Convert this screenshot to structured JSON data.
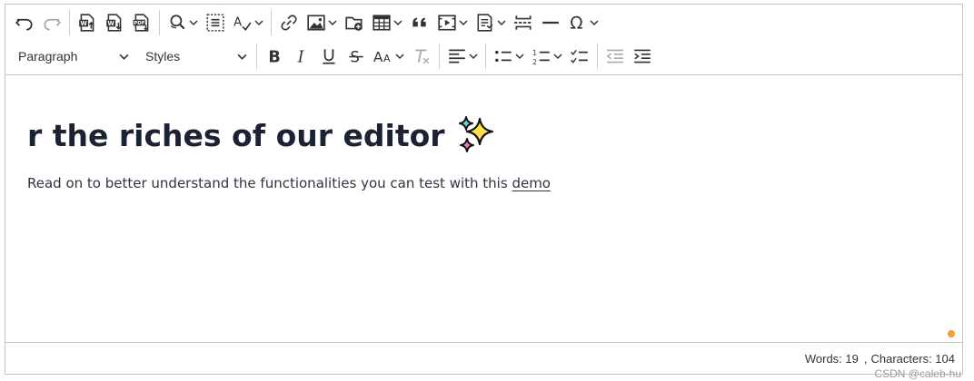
{
  "toolbar": {
    "row1": [
      {
        "icon": "undo-icon",
        "label": "Undo"
      },
      {
        "icon": "redo-icon",
        "label": "Redo"
      },
      {
        "icon": "import-word-icon",
        "label": "Import from Word"
      },
      {
        "icon": "export-word-icon",
        "label": "Export to Word"
      },
      {
        "icon": "export-pdf-icon",
        "label": "Export to PDF"
      },
      {
        "icon": "find-replace-icon",
        "label": "Find and replace"
      },
      {
        "icon": "select-all-icon",
        "label": "Select all"
      },
      {
        "icon": "spell-check-icon",
        "label": "Spell check"
      },
      {
        "icon": "link-icon",
        "label": "Link"
      },
      {
        "icon": "image-icon",
        "label": "Insert image"
      },
      {
        "icon": "media-browser-icon",
        "label": "Insert media"
      },
      {
        "icon": "table-icon",
        "label": "Insert table"
      },
      {
        "icon": "blockquote-icon",
        "label": "Block quote"
      },
      {
        "icon": "media-embed-icon",
        "label": "Insert media embed"
      },
      {
        "icon": "template-icon",
        "label": "Insert template"
      },
      {
        "icon": "page-break-icon",
        "label": "Page break"
      },
      {
        "icon": "horizontal-line-icon",
        "label": "Horizontal line"
      },
      {
        "icon": "special-characters-icon",
        "label": "Special characters"
      }
    ],
    "paragraph_value": "Paragraph",
    "styles_value": "Styles",
    "row2": [
      {
        "icon": "bold-icon",
        "label": "Bold"
      },
      {
        "icon": "italic-icon",
        "label": "Italic"
      },
      {
        "icon": "underline-icon",
        "label": "Underline"
      },
      {
        "icon": "strikethrough-icon",
        "label": "Strikethrough"
      },
      {
        "icon": "font-size-icon",
        "label": "Font size"
      },
      {
        "icon": "remove-format-icon",
        "label": "Remove format"
      },
      {
        "icon": "align-left-icon",
        "label": "Text alignment"
      },
      {
        "icon": "bulleted-list-icon",
        "label": "Bulleted list"
      },
      {
        "icon": "numbered-list-icon",
        "label": "Numbered list"
      },
      {
        "icon": "todo-list-icon",
        "label": "To-do list"
      },
      {
        "icon": "outdent-icon",
        "label": "Decrease indent"
      },
      {
        "icon": "indent-icon",
        "label": "Increase indent"
      }
    ]
  },
  "content": {
    "heading": "r the riches of our editor",
    "heading_emoji": "sparkles-icon",
    "paragraph_text": "Read on to better understand the functionalities you can test with this ",
    "paragraph_link": "demo"
  },
  "status": {
    "words": "Words: 19",
    "characters": "Characters: 104"
  },
  "watermark": "CSDN @caleb-hu",
  "colors": {
    "border": "#c4c4c4",
    "heading": "#1a2233",
    "dot": "#f39c3b",
    "sparkle_yellow": "#ffe14d",
    "sparkle_blue": "#6ad3e3",
    "sparkle_pink": "#f37ab8"
  }
}
